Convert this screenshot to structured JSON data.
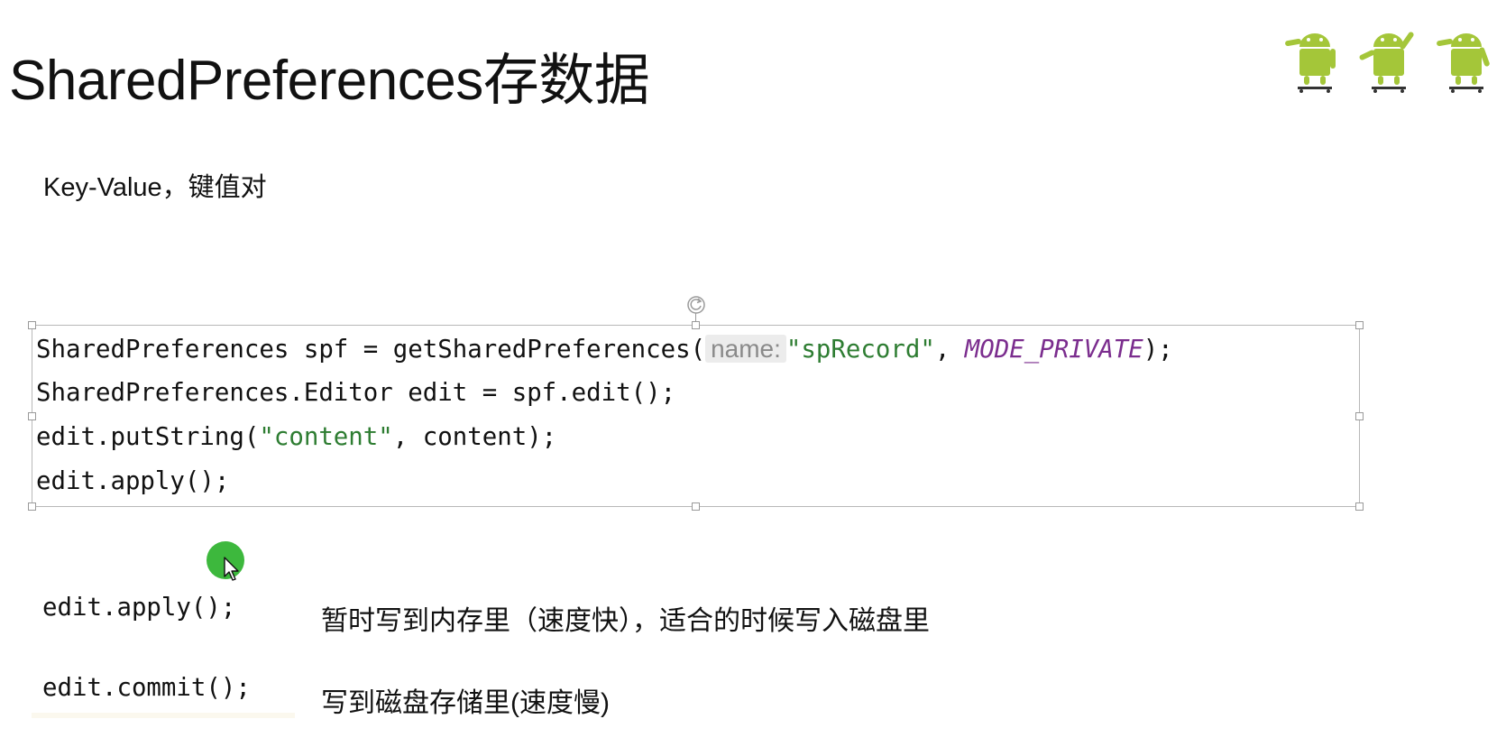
{
  "slide": {
    "title": "SharedPreferences存数据",
    "subtitle": "Key-Value，键值对"
  },
  "code_block": {
    "line1": {
      "prefix": "SharedPreferences spf = getSharedPreferences(",
      "hint": "name:",
      "string": "\"spRecord\"",
      "sep": ", ",
      "constant": "MODE_PRIVATE",
      "suffix": ");"
    },
    "line2": "SharedPreferences.Editor edit = spf.edit();",
    "line3": {
      "prefix": "edit.putString(",
      "string": "\"content\"",
      "suffix": ", content);"
    },
    "line4": "edit.apply();"
  },
  "notes": {
    "apply": {
      "method": "edit.apply();",
      "description": "暂时写到内存里（速度快），适合的时候写入磁盘里"
    },
    "commit": {
      "method": "edit.commit();",
      "description": "写到磁盘存储里(速度慢)"
    }
  },
  "colors": {
    "string": "#2e7d32",
    "constant": "#7b2d8e",
    "android_green": "#a4c639",
    "cursor_highlight": "#3db83d"
  },
  "icons": [
    "android-mascot-icon",
    "rotate-handle-icon",
    "mouse-pointer-icon"
  ]
}
